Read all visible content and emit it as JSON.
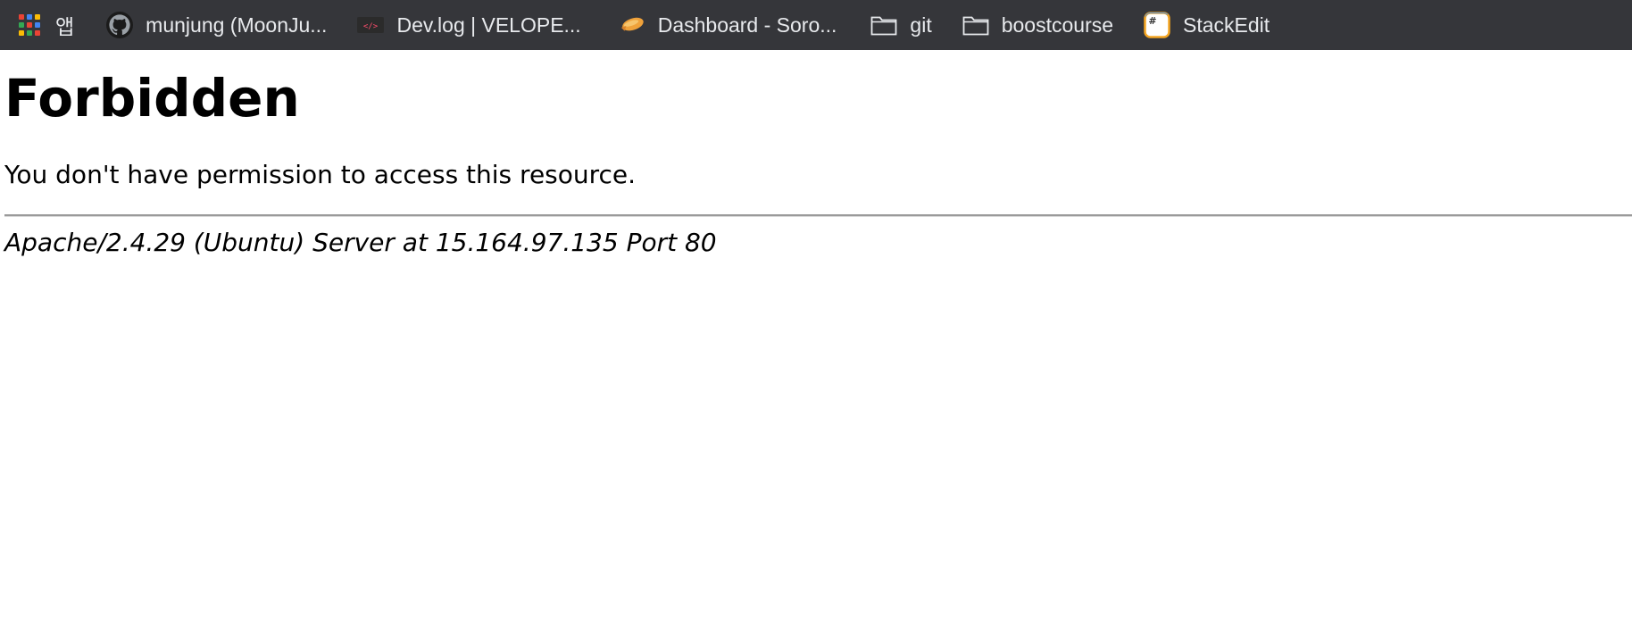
{
  "bookmarks_bar": {
    "background": "#35363a",
    "items": [
      {
        "label": "앱",
        "icon": "apps-grid-icon"
      },
      {
        "label": "munjung (MoonJu...",
        "icon": "github-icon"
      },
      {
        "label": "Dev.log | VELOPE...",
        "icon": "velog-icon"
      },
      {
        "label": "Dashboard - Soro...",
        "icon": "blimp-icon"
      },
      {
        "label": "git",
        "icon": "folder-icon"
      },
      {
        "label": "boostcourse",
        "icon": "folder-icon"
      },
      {
        "label": "StackEdit",
        "icon": "stackedit-icon"
      }
    ]
  },
  "page": {
    "heading": "Forbidden",
    "message": "You don't have permission to access this resource.",
    "server_signature": "Apache/2.4.29 (Ubuntu) Server at 15.164.97.135 Port 80"
  }
}
